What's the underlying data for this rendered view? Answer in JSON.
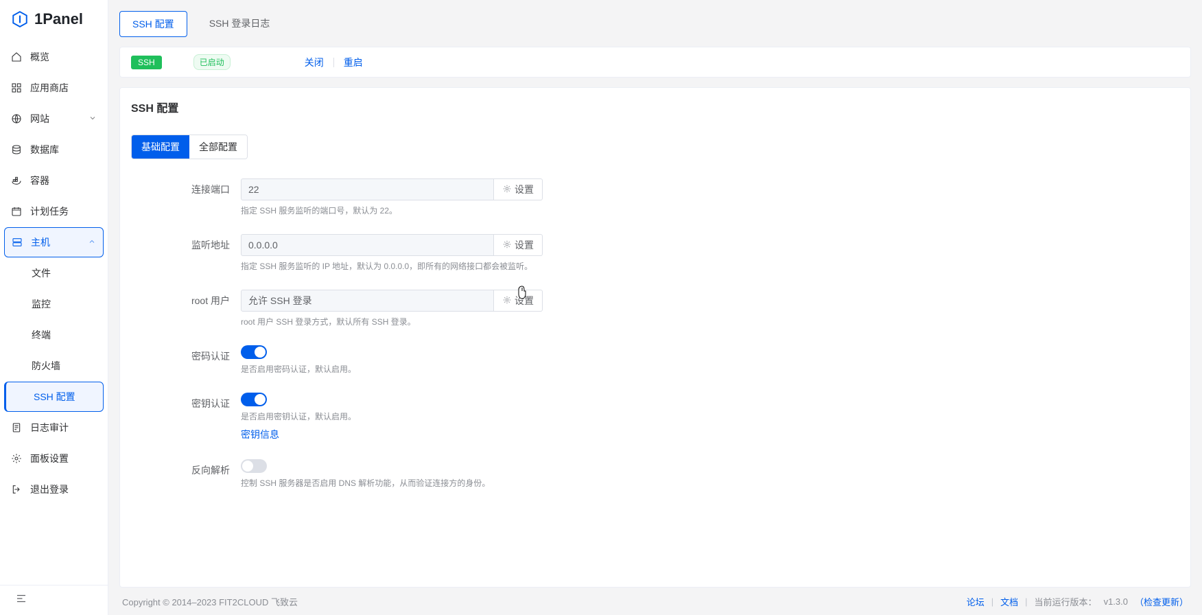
{
  "logo": {
    "text": "1Panel"
  },
  "sidebar": {
    "items": [
      {
        "label": "概览"
      },
      {
        "label": "应用商店"
      },
      {
        "label": "网站"
      },
      {
        "label": "数据库"
      },
      {
        "label": "容器"
      },
      {
        "label": "计划任务"
      },
      {
        "label": "主机"
      },
      {
        "label": "文件"
      },
      {
        "label": "监控"
      },
      {
        "label": "终端"
      },
      {
        "label": "防火墙"
      },
      {
        "label": "SSH 配置"
      },
      {
        "label": "日志审计"
      },
      {
        "label": "面板设置"
      },
      {
        "label": "退出登录"
      }
    ]
  },
  "tabs": {
    "config": "SSH 配置",
    "log": "SSH 登录日志"
  },
  "status": {
    "badge": "SSH",
    "state": "已启动",
    "close": "关闭",
    "restart": "重启"
  },
  "page": {
    "title": "SSH 配置"
  },
  "segments": {
    "basic": "基础配置",
    "all": "全部配置"
  },
  "form": {
    "port": {
      "label": "连接端口",
      "value": "22",
      "btn": "设置",
      "hint": "指定 SSH 服务监听的端口号，默认为 22。"
    },
    "listen": {
      "label": "监听地址",
      "value": "0.0.0.0",
      "btn": "设置",
      "hint": "指定 SSH 服务监听的 IP 地址，默认为 0.0.0.0，即所有的网络接口都会被监听。"
    },
    "root": {
      "label": "root 用户",
      "value": "允许 SSH 登录",
      "btn": "设置",
      "hint": "root 用户 SSH 登录方式，默认所有 SSH 登录。"
    },
    "password": {
      "label": "密码认证",
      "hint": "是否启用密码认证，默认启用。"
    },
    "key": {
      "label": "密钥认证",
      "hint": "是否启用密钥认证，默认启用。",
      "link": "密钥信息"
    },
    "reverse": {
      "label": "反向解析",
      "hint": "控制 SSH 服务器是否启用 DNS 解析功能，从而验证连接方的身份。"
    }
  },
  "footer": {
    "copyright": "Copyright © 2014–2023 FIT2CLOUD 飞致云",
    "forum": "论坛",
    "docs": "文档",
    "version_label": "当前运行版本：",
    "version": "v1.3.0",
    "check": "（检查更新）"
  }
}
